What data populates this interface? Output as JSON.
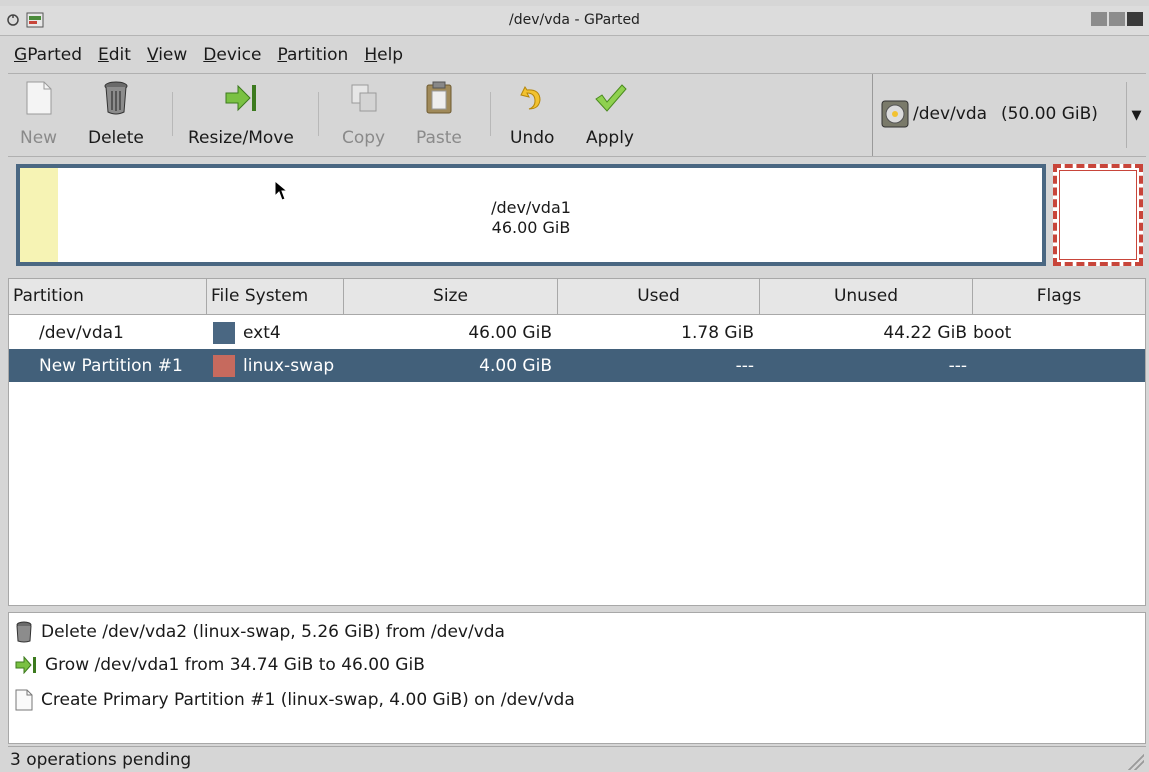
{
  "window": {
    "title": "/dev/vda - GParted"
  },
  "menubar": [
    {
      "pre": "",
      "ul": "G",
      "post": "Parted"
    },
    {
      "pre": "",
      "ul": "E",
      "post": "dit"
    },
    {
      "pre": "",
      "ul": "V",
      "post": "iew"
    },
    {
      "pre": "",
      "ul": "D",
      "post": "evice"
    },
    {
      "pre": "",
      "ul": "P",
      "post": "artition"
    },
    {
      "pre": "",
      "ul": "H",
      "post": "elp"
    }
  ],
  "toolbar": {
    "new_label": "New",
    "delete_label": "Delete",
    "resize_label": "Resize/Move",
    "copy_label": "Copy",
    "paste_label": "Paste",
    "undo_label": "Undo",
    "apply_label": "Apply"
  },
  "device_selector": {
    "device": "/dev/vda",
    "size": "(50.00 GiB)"
  },
  "disk_graphic": {
    "partition_name": "/dev/vda1",
    "partition_size": "46.00 GiB",
    "used_fraction": 0.039
  },
  "table": {
    "headers": [
      "Partition",
      "File System",
      "Size",
      "Used",
      "Unused",
      "Flags"
    ],
    "rows": [
      {
        "partition": "/dev/vda1",
        "fs": "ext4",
        "fs_color": "#4a6782",
        "size": "46.00 GiB",
        "used": "1.78 GiB",
        "unused": "44.22 GiB",
        "flags": "boot"
      },
      {
        "partition": "New Partition #1",
        "fs": "linux-swap",
        "fs_color": "#c66a5e",
        "size": "4.00 GiB",
        "used": "---",
        "unused": "---",
        "flags": ""
      }
    ]
  },
  "operations": [
    {
      "icon": "trash-icon",
      "text": "Delete /dev/vda2 (linux-swap, 5.26 GiB) from /dev/vda"
    },
    {
      "icon": "resize-arrow-icon",
      "text": "Grow /dev/vda1 from 34.74 GiB to 46.00 GiB"
    },
    {
      "icon": "new-document-icon",
      "text": "Create Primary Partition #1 (linux-swap, 4.00 GiB) on /dev/vda"
    }
  ],
  "status": {
    "text": "3 operations pending"
  },
  "colors": {
    "selection": "#42607a",
    "ext4": "#4a6782",
    "linux_swap": "#c66a5e",
    "unallocated_border": "#c8453a"
  }
}
